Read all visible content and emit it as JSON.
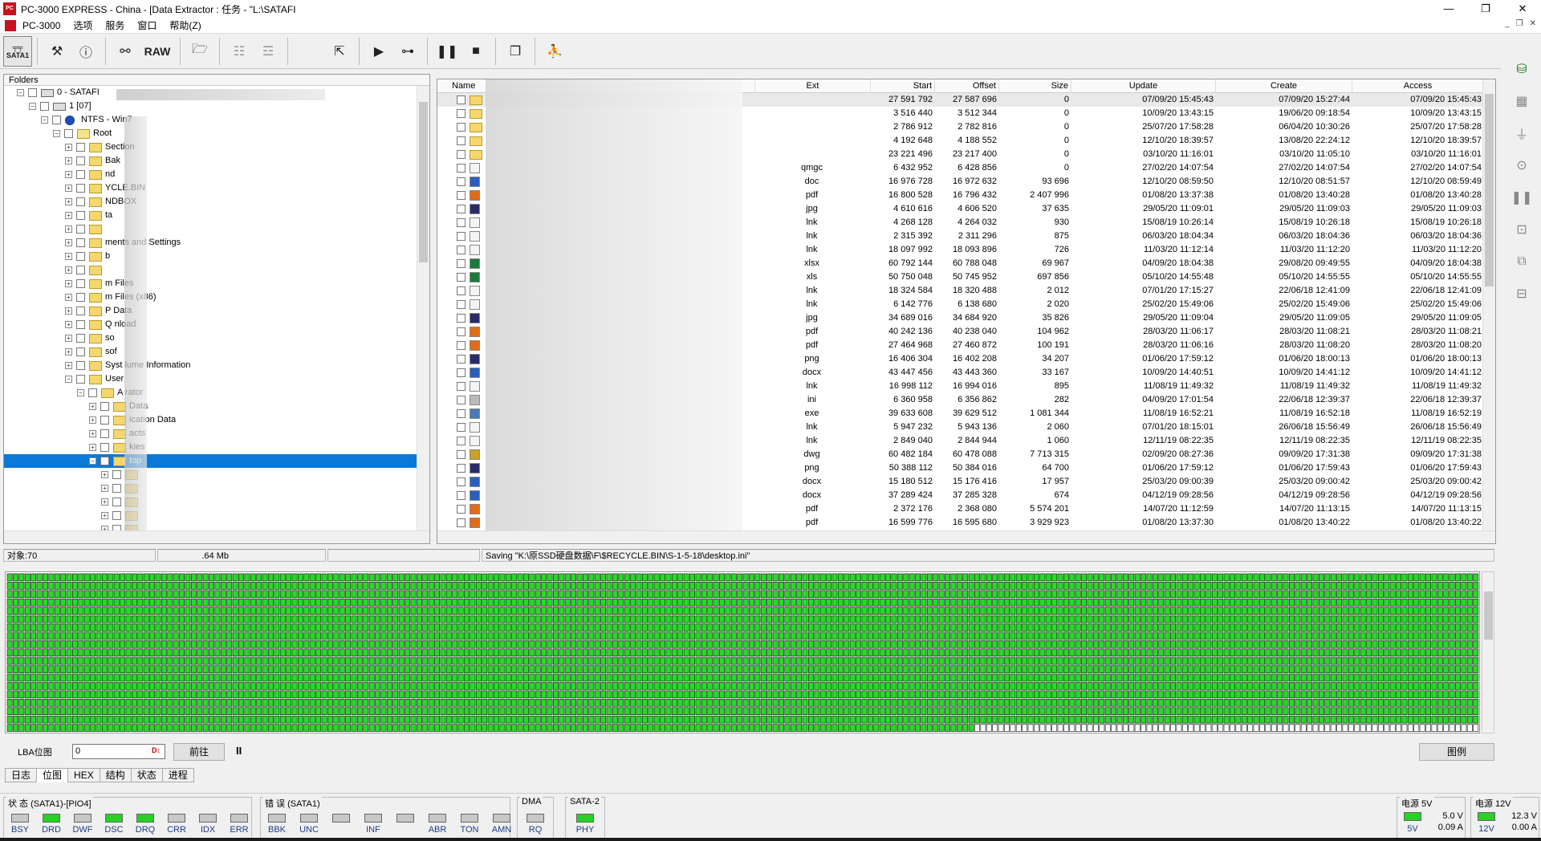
{
  "window": {
    "title": "PC-3000 EXPRESS - China - [Data Extractor : 任务 - \"L:\\SATAFI",
    "app_icon": "PC",
    "controls": [
      "—",
      "❐",
      "✕"
    ]
  },
  "menu": {
    "items": [
      "PC-3000",
      "选项",
      "服务",
      "窗口",
      "帮助(Z)"
    ],
    "mdi_controls": [
      "_",
      "❐",
      "✕"
    ]
  },
  "toolbar": {
    "sata_label": "SATA1",
    "raw_label": "RAW"
  },
  "folders": {
    "header": "Folders",
    "rows": [
      {
        "level": 0,
        "exp": "−",
        "icon": "drive",
        "label": "0 - SATAFI"
      },
      {
        "level": 1,
        "exp": "−",
        "icon": "drive",
        "label": "1 [07]"
      },
      {
        "level": 2,
        "exp": "−",
        "icon": "ntfs",
        "label": "NTFS - Win7"
      },
      {
        "level": 3,
        "exp": "−",
        "icon": "root",
        "label": "Root"
      },
      {
        "level": 4,
        "exp": "+",
        "icon": "folder",
        "label": "Section"
      },
      {
        "level": 4,
        "exp": "+",
        "icon": "folder",
        "label": "Bak"
      },
      {
        "level": 4,
        "exp": "+",
        "icon": "folder",
        "label": "nd"
      },
      {
        "level": 4,
        "exp": "+",
        "icon": "folder",
        "label": "YCLE.BIN"
      },
      {
        "level": 4,
        "exp": "+",
        "icon": "folder",
        "label": "NDBOX"
      },
      {
        "level": 4,
        "exp": "+",
        "icon": "folder",
        "label": "ta"
      },
      {
        "level": 4,
        "exp": "+",
        "icon": "folder",
        "label": ""
      },
      {
        "level": 4,
        "exp": "+",
        "icon": "folder",
        "label": "ments and Settings"
      },
      {
        "level": 4,
        "exp": "+",
        "icon": "folder",
        "label": "b"
      },
      {
        "level": 4,
        "exp": "+",
        "icon": "folder",
        "label": ""
      },
      {
        "level": 4,
        "exp": "+",
        "icon": "folder",
        "label": "m Files"
      },
      {
        "level": 4,
        "exp": "+",
        "icon": "folder",
        "label": "m Files (x86)"
      },
      {
        "level": 4,
        "exp": "+",
        "icon": "folder",
        "label": "P    Data"
      },
      {
        "level": 4,
        "exp": "+",
        "icon": "folder",
        "label": "Q    nload"
      },
      {
        "level": 4,
        "exp": "+",
        "icon": "folder",
        "label": "so"
      },
      {
        "level": 4,
        "exp": "+",
        "icon": "folder",
        "label": "sof"
      },
      {
        "level": 4,
        "exp": "+",
        "icon": "folder",
        "label": "Syst     lume Information"
      },
      {
        "level": 4,
        "exp": "−",
        "icon": "folder",
        "label": "User"
      },
      {
        "level": 5,
        "exp": "−",
        "icon": "folder",
        "label": "A      rator"
      },
      {
        "level": 6,
        "exp": "+",
        "icon": "folder",
        "label": "Data"
      },
      {
        "level": 6,
        "exp": "+",
        "icon": "folder",
        "label": "ication Data"
      },
      {
        "level": 6,
        "exp": "+",
        "icon": "folder",
        "label": "acts"
      },
      {
        "level": 6,
        "exp": "+",
        "icon": "folder",
        "label": "kies"
      },
      {
        "level": 6,
        "exp": "−",
        "icon": "folder",
        "label": "top",
        "selected": true
      },
      {
        "level": 7,
        "exp": "+",
        "icon": "folder",
        "label": ""
      },
      {
        "level": 7,
        "exp": "+",
        "icon": "folder",
        "label": ""
      },
      {
        "level": 7,
        "exp": "+",
        "icon": "folder",
        "label": ""
      },
      {
        "level": 7,
        "exp": "+",
        "icon": "folder",
        "label": ""
      },
      {
        "level": 7,
        "exp": "+",
        "icon": "folder",
        "label": ""
      }
    ]
  },
  "files": {
    "columns": [
      "Name",
      "Ext",
      "Start",
      "Offset",
      "Size",
      "Update",
      "Create",
      "Access"
    ],
    "rows": [
      {
        "icon": "folder",
        "ext": "",
        "start": "27 591 792",
        "offset": "27 587 696",
        "size": "0",
        "update": "07/09/20 15:45:43",
        "create": "07/09/20 15:27:44",
        "access": "07/09/20 15:45:43"
      },
      {
        "icon": "folder",
        "ext": "",
        "start": "3 516 440",
        "offset": "3 512 344",
        "size": "0",
        "update": "10/09/20 13:43:15",
        "create": "19/06/20 09:18:54",
        "access": "10/09/20 13:43:15"
      },
      {
        "icon": "folder",
        "ext": "",
        "start": "2 786 912",
        "offset": "2 782 816",
        "size": "0",
        "update": "25/07/20 17:58:28",
        "create": "06/04/20 10:30:26",
        "access": "25/07/20 17:58:28"
      },
      {
        "icon": "folder",
        "ext": "",
        "start": "4 192 648",
        "offset": "4 188 552",
        "size": "0",
        "update": "12/10/20 18:39:57",
        "create": "13/08/20 22:24:12",
        "access": "12/10/20 18:39:57"
      },
      {
        "icon": "folder",
        "ext": "",
        "start": "23 221 496",
        "offset": "23 217 400",
        "size": "0",
        "update": "03/10/20 11:16:01",
        "create": "03/10/20 11:05:10",
        "access": "03/10/20 11:16:01"
      },
      {
        "icon": "lnk",
        "ext": "qmgc",
        "start": "6 432 952",
        "offset": "6 428 856",
        "size": "0",
        "update": "27/02/20 14:07:54",
        "create": "27/02/20 14:07:54",
        "access": "27/02/20 14:07:54"
      },
      {
        "icon": "doc",
        "ext": "doc",
        "start": "16 976 728",
        "offset": "16 972 632",
        "size": "93 696",
        "update": "12/10/20 08:59:50",
        "create": "12/10/20 08:51:57",
        "access": "12/10/20 08:59:49"
      },
      {
        "icon": "pdf",
        "ext": "pdf",
        "start": "16 800 528",
        "offset": "16 796 432",
        "size": "2 407 996",
        "update": "01/08/20 13:37:38",
        "create": "01/08/20 13:40:28",
        "access": "01/08/20 13:40:28"
      },
      {
        "icon": "img",
        "ext": "jpg",
        "start": "4 610 616",
        "offset": "4 606 520",
        "size": "37 635",
        "update": "29/05/20 11:09:01",
        "create": "29/05/20 11:09:03",
        "access": "29/05/20 11:09:03"
      },
      {
        "icon": "lnk",
        "ext": "lnk",
        "start": "4 268 128",
        "offset": "4 264 032",
        "size": "930",
        "update": "15/08/19 10:26:14",
        "create": "15/08/19 10:26:18",
        "access": "15/08/19 10:26:18"
      },
      {
        "icon": "lnk",
        "ext": "lnk",
        "start": "2 315 392",
        "offset": "2 311 296",
        "size": "875",
        "update": "06/03/20 18:04:34",
        "create": "06/03/20 18:04:36",
        "access": "06/03/20 18:04:36"
      },
      {
        "icon": "lnk",
        "ext": "lnk",
        "start": "18 097 992",
        "offset": "18 093 896",
        "size": "726",
        "update": "11/03/20 11:12:14",
        "create": "11/03/20 11:12:20",
        "access": "11/03/20 11:12:20"
      },
      {
        "icon": "xls",
        "ext": "xlsx",
        "start": "60 792 144",
        "offset": "60 788 048",
        "size": "69 967",
        "update": "04/09/20 18:04:38",
        "create": "29/08/20 09:49:55",
        "access": "04/09/20 18:04:38"
      },
      {
        "icon": "xls",
        "ext": "xls",
        "start": "50 750 048",
        "offset": "50 745 952",
        "size": "697 856",
        "update": "05/10/20 14:55:48",
        "create": "05/10/20 14:55:55",
        "access": "05/10/20 14:55:55"
      },
      {
        "icon": "lnk",
        "ext": "lnk",
        "start": "18 324 584",
        "offset": "18 320 488",
        "size": "2 012",
        "update": "07/01/20 17:15:27",
        "create": "22/06/18 12:41:09",
        "access": "22/06/18 12:41:09"
      },
      {
        "icon": "lnk",
        "ext": "lnk",
        "start": "6 142 776",
        "offset": "6 138 680",
        "size": "2 020",
        "update": "25/02/20 15:49:06",
        "create": "25/02/20 15:49:06",
        "access": "25/02/20 15:49:06"
      },
      {
        "icon": "img",
        "ext": "jpg",
        "start": "34 689 016",
        "offset": "34 684 920",
        "size": "35 826",
        "update": "29/05/20 11:09:04",
        "create": "29/05/20 11:09:05",
        "access": "29/05/20 11:09:05"
      },
      {
        "icon": "pdf",
        "ext": "pdf",
        "start": "40 242 136",
        "offset": "40 238 040",
        "size": "104 962",
        "update": "28/03/20 11:06:17",
        "create": "28/03/20 11:08:21",
        "access": "28/03/20 11:08:21"
      },
      {
        "icon": "pdf",
        "ext": "pdf",
        "start": "27 464 968",
        "offset": "27 460 872",
        "size": "100 191",
        "update": "28/03/20 11:06:16",
        "create": "28/03/20 11:08:20",
        "access": "28/03/20 11:08:20"
      },
      {
        "icon": "img",
        "ext": "png",
        "start": "16 406 304",
        "offset": "16 402 208",
        "size": "34 207",
        "update": "01/06/20 17:59:12",
        "create": "01/06/20 18:00:13",
        "access": "01/06/20 18:00:13"
      },
      {
        "icon": "doc",
        "ext": "docx",
        "start": "43 447 456",
        "offset": "43 443 360",
        "size": "33 167",
        "update": "10/09/20 14:40:51",
        "create": "10/09/20 14:41:12",
        "access": "10/09/20 14:41:12"
      },
      {
        "icon": "lnk",
        "ext": "lnk",
        "start": "16 998 112",
        "offset": "16 994 016",
        "size": "895",
        "update": "11/08/19 11:49:32",
        "create": "11/08/19 11:49:32",
        "access": "11/08/19 11:49:32"
      },
      {
        "icon": "ini",
        "ext": "ini",
        "start": "6 360 958",
        "offset": "6 356 862",
        "size": "282",
        "update": "04/09/20 17:01:54",
        "create": "22/06/18 12:39:37",
        "access": "22/06/18 12:39:37"
      },
      {
        "icon": "exe",
        "ext": "exe",
        "start": "39 633 608",
        "offset": "39 629 512",
        "size": "1 081 344",
        "update": "11/08/19 16:52:21",
        "create": "11/08/19 16:52:18",
        "access": "11/08/19 16:52:19"
      },
      {
        "icon": "lnk",
        "ext": "lnk",
        "start": "5 947 232",
        "offset": "5 943 136",
        "size": "2 060",
        "update": "07/01/20 18:15:01",
        "create": "26/06/18 15:56:49",
        "access": "26/06/18 15:56:49"
      },
      {
        "icon": "lnk",
        "ext": "lnk",
        "start": "2 849 040",
        "offset": "2 844 944",
        "size": "1 060",
        "update": "12/11/19 08:22:35",
        "create": "12/11/19 08:22:35",
        "access": "12/11/19 08:22:35"
      },
      {
        "icon": "dwg",
        "ext": "dwg",
        "start": "60 482 184",
        "offset": "60 478 088",
        "size": "7 713 315",
        "update": "02/09/20 08:27:36",
        "create": "09/09/20 17:31:38",
        "access": "09/09/20 17:31:38"
      },
      {
        "icon": "img",
        "ext": "png",
        "start": "50 388 112",
        "offset": "50 384 016",
        "size": "64 700",
        "update": "01/06/20 17:59:12",
        "create": "01/06/20 17:59:43",
        "access": "01/06/20 17:59:43"
      },
      {
        "icon": "doc",
        "ext": "docx",
        "start": "15 180 512",
        "offset": "15 176 416",
        "size": "17 957",
        "update": "25/03/20 09:00:39",
        "create": "25/03/20 09:00:42",
        "access": "25/03/20 09:00:42"
      },
      {
        "icon": "doc",
        "ext": "docx",
        "start": "37 289 424",
        "offset": "37 285 328",
        "size": "674",
        "update": "04/12/19 09:28:56",
        "create": "04/12/19 09:28:56",
        "access": "04/12/19 09:28:56"
      },
      {
        "icon": "pdf",
        "ext": "pdf",
        "start": "2 372 176",
        "offset": "2 368 080",
        "size": "5 574 201",
        "update": "14/07/20 11:12:59",
        "create": "14/07/20 11:13:15",
        "access": "14/07/20 11:13:15"
      },
      {
        "icon": "pdf",
        "ext": "pdf",
        "start": "16 599 776",
        "offset": "16 595 680",
        "size": "3 929 923",
        "update": "01/08/20 13:37:30",
        "create": "01/08/20 13:40:22",
        "access": "01/08/20 13:40:22"
      }
    ]
  },
  "status": {
    "objects": "对象:70",
    "size": ".64 Mb",
    "saving": "Saving  \"K:\\原SSD硬盘数据\\F\\$RECYCLE.BIN\\S-1-5-18\\desktop.ini\""
  },
  "blockmap": {
    "rows": 19,
    "cols": 248,
    "filled_full_rows": 18,
    "partial_row_filled": 0.6575,
    "colors": {
      "filled": "#22dd22",
      "empty": "#ffffff",
      "border": "#2a2a2a"
    }
  },
  "lba": {
    "label": "LBA位图",
    "value": "0",
    "go_label": "前往",
    "pause_label": "II",
    "legend_label": "图例"
  },
  "tabs": [
    "日志",
    "位图",
    "HEX",
    "结构",
    "状态",
    "进程"
  ],
  "indicators": {
    "status_group": {
      "title": "状 态 (SATA1)-[PIO4]",
      "leds": [
        {
          "label": "BSY",
          "on": false
        },
        {
          "label": "DRD",
          "on": true
        },
        {
          "label": "DWF",
          "on": false
        },
        {
          "label": "DSC",
          "on": true
        },
        {
          "label": "DRQ",
          "on": true
        },
        {
          "label": "CRR",
          "on": false
        },
        {
          "label": "IDX",
          "on": false
        },
        {
          "label": "ERR",
          "on": false
        }
      ]
    },
    "error_group": {
      "title": "错 误 (SATA1)",
      "leds": [
        {
          "label": "BBK",
          "on": false
        },
        {
          "label": "UNC",
          "on": false
        },
        {
          "label": "",
          "on": false
        },
        {
          "label": "INF",
          "on": false
        },
        {
          "label": "",
          "on": false
        },
        {
          "label": "ABR",
          "on": false
        },
        {
          "label": "TON",
          "on": false
        },
        {
          "label": "AMN",
          "on": false
        }
      ]
    },
    "dma_group": {
      "title": "DMA",
      "leds": [
        {
          "label": "RQ",
          "on": false
        }
      ]
    },
    "sata_group": {
      "title": "SATA-2",
      "leds": [
        {
          "label": "PHY",
          "on": true
        }
      ]
    },
    "power5": {
      "title": "电源 5V",
      "label": "5V",
      "voltage": "5.0 V",
      "current": "0.09 A"
    },
    "power12": {
      "title": "电源 12V",
      "label": "12V",
      "voltage": "12.3 V",
      "current": "0.00 A"
    }
  }
}
